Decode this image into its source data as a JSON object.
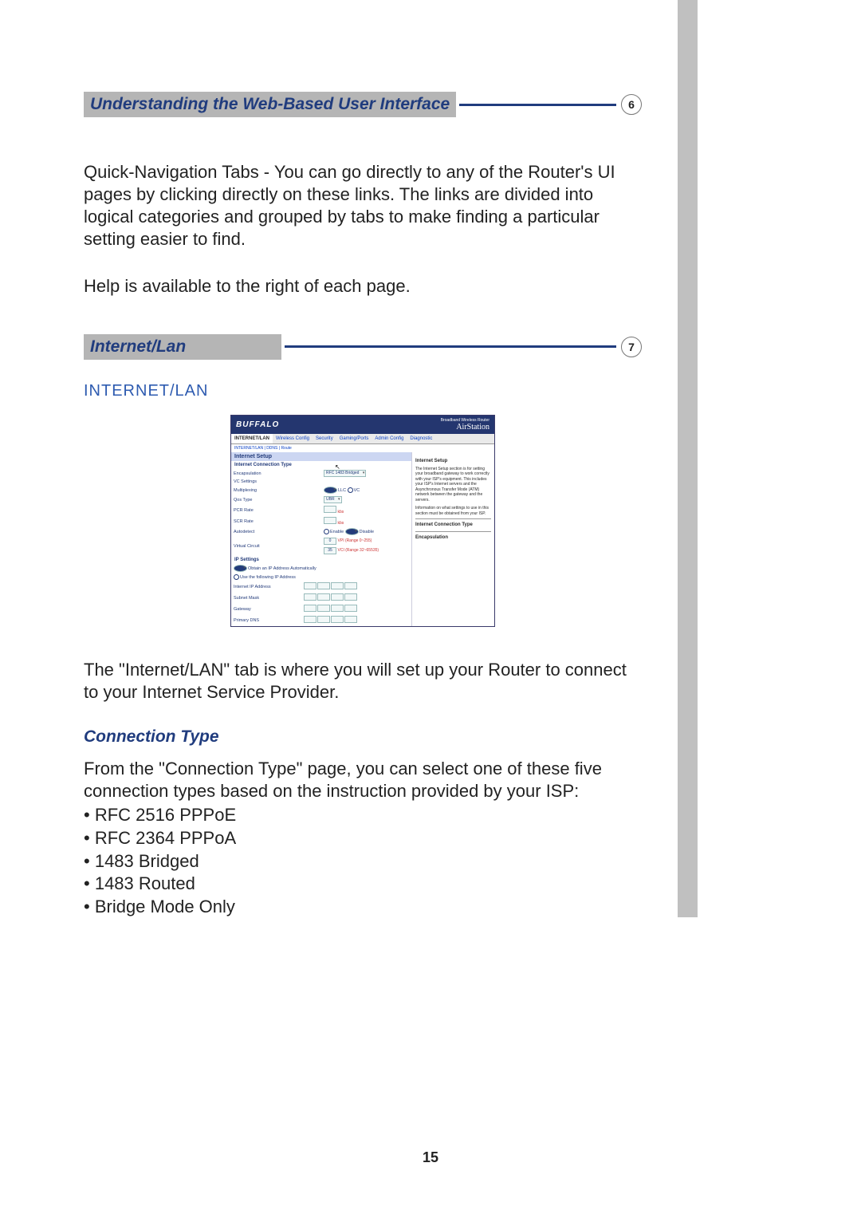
{
  "heading1": {
    "title": "Understanding the Web-Based User Interface",
    "num": "6"
  },
  "para1": "Quick-Navigation Tabs - You can go directly to any of the Router's UI pages by clicking directly on these links. The links are divided into logical categories and grouped by tabs to make finding a particular setting easier to find.",
  "para2": "Help is available to the right of each page.",
  "heading2": {
    "title": "Internet/Lan",
    "num": "7"
  },
  "blueTitle": "INTERNET/LAN",
  "para3": "The \"Internet/LAN\" tab is where you will set up your Router to connect to your Internet Service Provider.",
  "connTypeTitle": "Connection Type",
  "para4": "From the \"Connection Type\" page, you can select one of these five connection types based on the instruction provided by your ISP:",
  "connTypes": [
    "RFC 2516 PPPoE",
    "RFC 2364 PPPoA",
    "1483 Bridged",
    "1483 Routed",
    "Bridge Mode Only"
  ],
  "pageNum": "15",
  "shot": {
    "brand": "BUFFALO",
    "headRight": "Broadband Wireless Router",
    "air": "AirStation",
    "tabs": [
      "INTERNET/LAN",
      "Wireless Config",
      "Security",
      "Gaming/Ports",
      "Admin Config",
      "Diagnostic"
    ],
    "crumbs": "INTERNET/LAN  |  DDNS  |  Route",
    "secTitle": "Internet Setup",
    "subTitle": "Internet Connection Type",
    "rows": {
      "encap": "Encapsulation",
      "encapVal": "RFC 1483 Bridged",
      "vc": "VC Settings",
      "mult": "Multiplexing",
      "multOpt1": "LLC",
      "multOpt2": "VC",
      "qos": "Qos Type",
      "qosVal": "UBR",
      "pcr": "PCR Rate",
      "pcrNote": "kbs",
      "scr": "SCR Rate",
      "scrNote": "kbs",
      "autod": "Autodetect",
      "autoOn": "Enable",
      "autoOff": "Disable",
      "virt": "Virtual Circuit",
      "vpi": "0",
      "vpiLabel": "VPI (Range 0~255)",
      "vci": "35",
      "vciLabel": "VCI (Range 32~65535)"
    },
    "ipTitle": "IP Settings",
    "ipAuto": "Obtain an IP Address Automatically",
    "ipManual": "Use the following IP Address",
    "ipRows": [
      "Internet IP Address",
      "Subnet Mask",
      "Gateway",
      "Primary DNS"
    ],
    "help": {
      "t1": "Internet Setup",
      "p1": "The Internet Setup section is for setting your broadband gateway to work correctly with your ISP's equipment. This includes your ISP's Internet servers and the Asynchronous Transfer Mode (ATM) network between the gateway and the servers.",
      "p2": "Information on what settings to use in this section must be obtained from your ISP.",
      "t2": "Internet Connection Type",
      "t3": "Encapsulation"
    }
  }
}
